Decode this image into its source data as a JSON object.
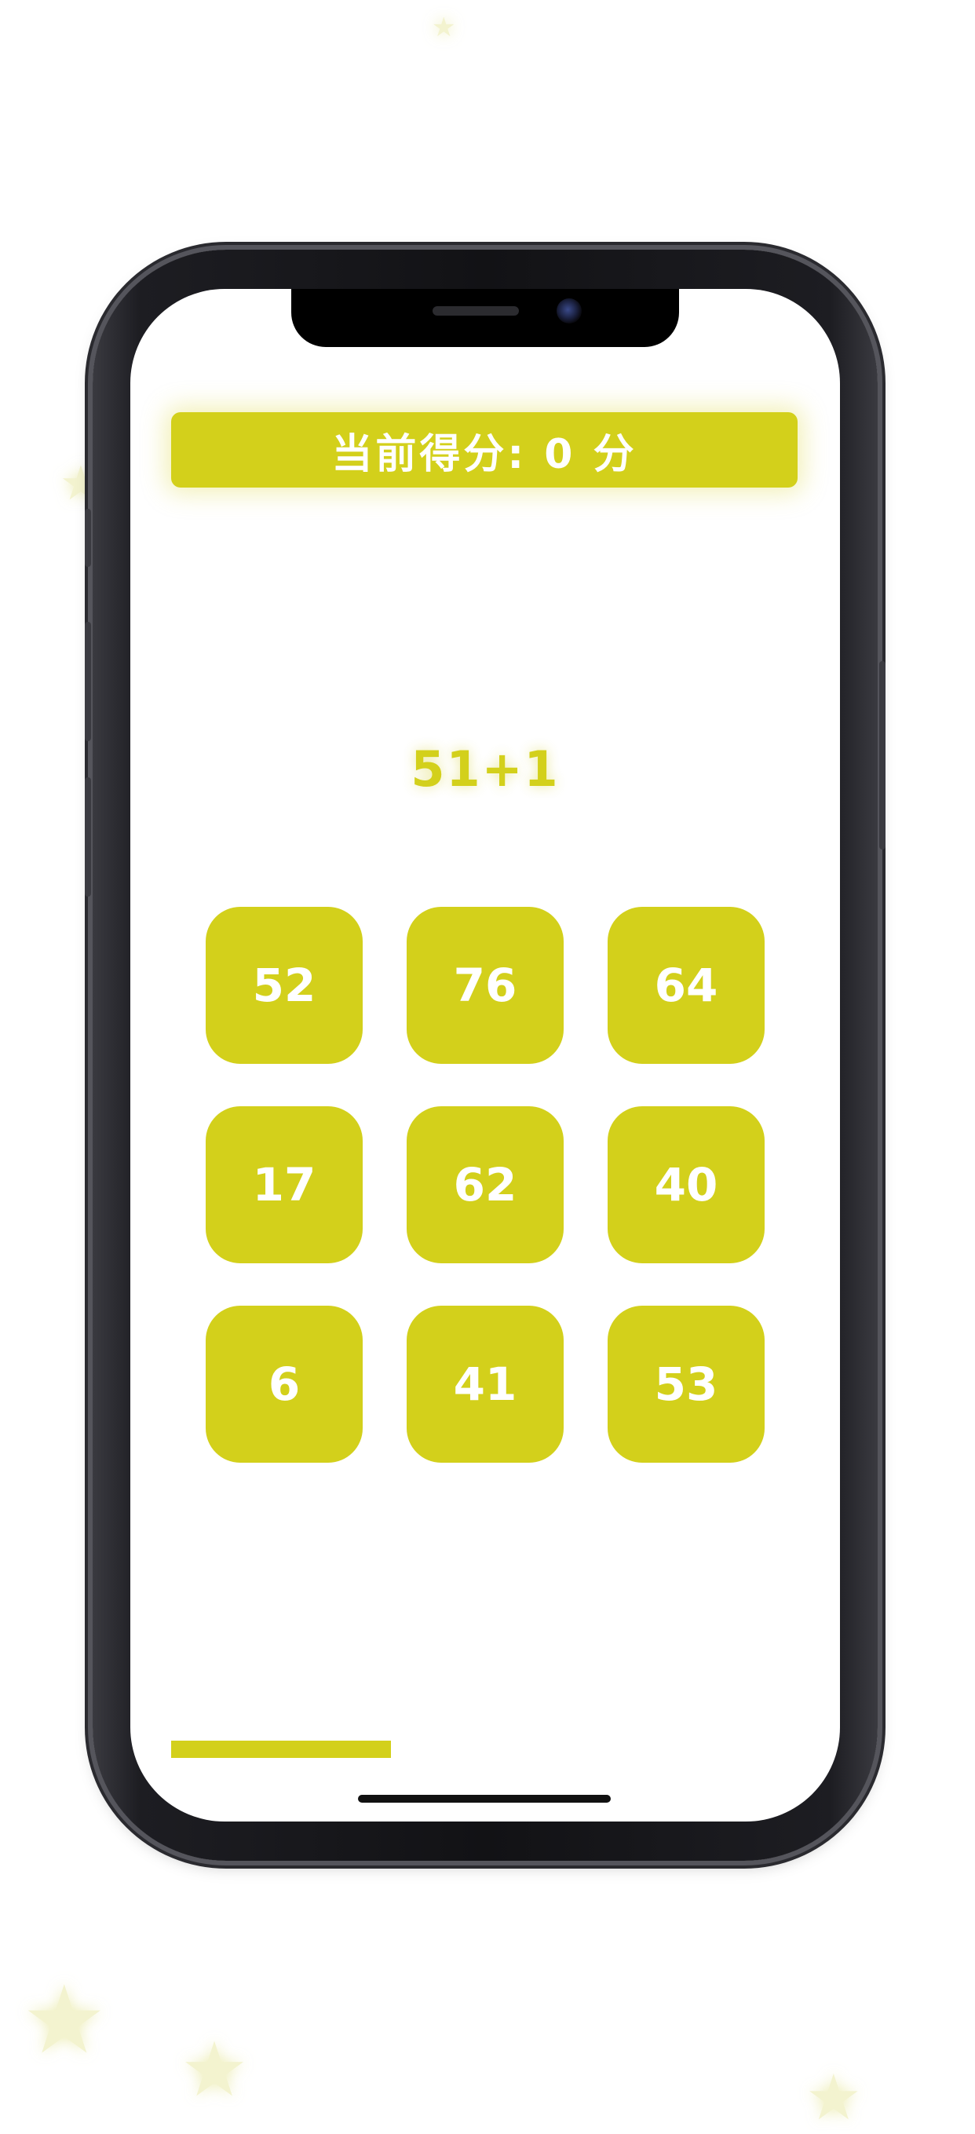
{
  "game": {
    "score_text": "当前得分: 0 分",
    "question": "51+1",
    "options": [
      "52",
      "76",
      "64",
      "17",
      "62",
      "40",
      "6",
      "41",
      "53"
    ],
    "progress": 0.35
  },
  "colors": {
    "accent": "#d3d01b",
    "background": "#ffffff",
    "tile_text": "#ffffff"
  }
}
